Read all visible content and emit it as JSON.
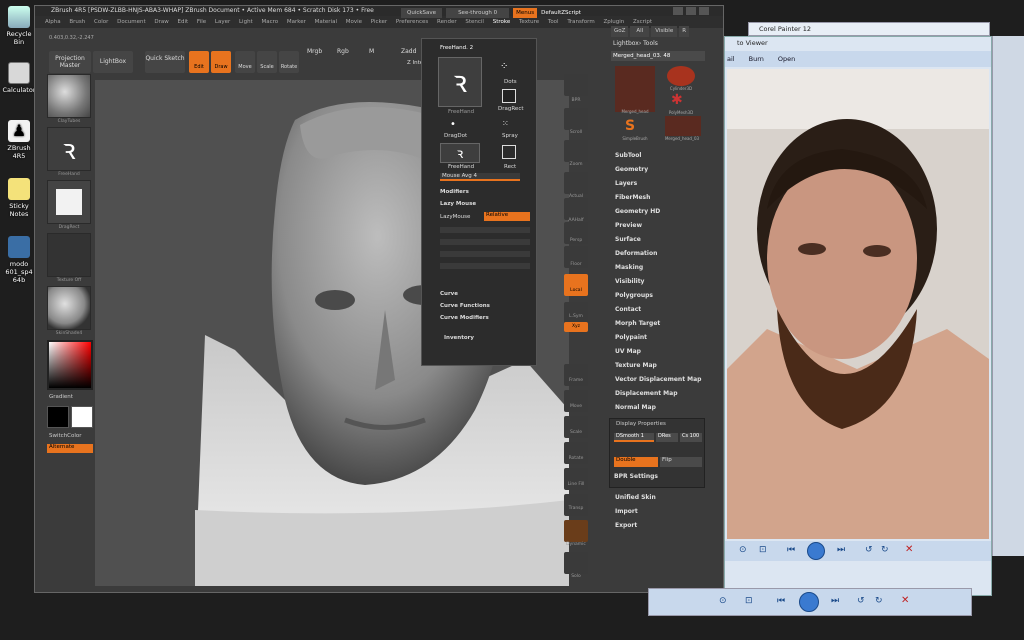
{
  "desktop": {
    "icons": [
      {
        "label": "Recycle Bin"
      },
      {
        "label": "Calculator"
      },
      {
        "label": "ZBrush 4R5"
      },
      {
        "label": "Sticky Notes"
      },
      {
        "label": "modo 601_sp4 64b"
      }
    ]
  },
  "zbrush": {
    "title": "ZBrush 4R5   [PSDW-ZLBB-HNJS-ABA3-WHAP]   ZBrush Document   • Active Mem 684 • Scratch Disk 173 • Free",
    "top": {
      "quicksave": "QuickSave",
      "seethrough": "See-through 0",
      "menus": "Menus",
      "script": "DefaultZScript"
    },
    "menus": [
      "Alpha",
      "Brush",
      "Color",
      "Document",
      "Draw",
      "Edit",
      "File",
      "Layer",
      "Light",
      "Macro",
      "Marker",
      "Material",
      "Movie",
      "Picker",
      "Preferences",
      "Render",
      "Stencil",
      "Stroke",
      "Texture",
      "Tool",
      "Transform",
      "Zplugin",
      "Zscript"
    ],
    "coords": "0.403,0.32,-2.247",
    "toolbar": {
      "projection_master": "Projection Master",
      "lightbox": "LightBox",
      "quick_sketch": "Quick Sketch",
      "edit": "Edit",
      "draw": "Draw",
      "move": "Move",
      "scale": "Scale",
      "rotate": "Rotate",
      "mrgb": "Mrgb",
      "rgb": "Rgb",
      "m": "M",
      "zadd": "Zadd",
      "zint": "Z Intensi"
    },
    "shelf": {
      "material_label": "ClayTubes",
      "brush_label": "FreeHand",
      "alpha_label": "DragRect",
      "texture_label": "Texture Off",
      "matcap_label": "SkinShade4",
      "gradient": "Gradient",
      "switch_color": "SwitchColor",
      "alternate": "Alternate"
    },
    "stroke_palette": {
      "header": "FreeHand. 2",
      "items": [
        {
          "label": "FreeHand"
        },
        {
          "label": "Dots"
        },
        {
          "label": "DragRect"
        },
        {
          "label": "DragDot"
        },
        {
          "label": "Spray"
        },
        {
          "label": "FreeHand"
        },
        {
          "label": "Rect"
        }
      ],
      "mouse_avg": "Mouse Avg 4",
      "modifiers": "Modifiers",
      "lazy_mouse": "Lazy Mouse",
      "lazymouse_label": "LazyMouse",
      "relative": "Relative",
      "curve": "Curve",
      "curve_functions": "Curve Functions",
      "curve_modifiers": "Curve Modifiers",
      "inventory": "Inventory"
    },
    "right_tools": [
      "BPR",
      "Scroll",
      "Zoom",
      "Actual",
      "AAHalf",
      "Persp",
      "Floor",
      "Local",
      "L.Sym",
      "Xyz",
      "Frame",
      "Move",
      "Scale",
      "Rotate",
      "Line Fill",
      "Transp",
      "Dynamic",
      "Solo"
    ],
    "tool_palette": {
      "goz": "GoZ",
      "all": "All",
      "visible": "Visible",
      "r": "R",
      "lightbox_tools": "Lightbox› Tools",
      "current": "Merged_head_03. 48",
      "thumbs": [
        {
          "label": "Merged_head"
        },
        {
          "label": "Cylinder3D"
        },
        {
          "label": "PolyMesh3D"
        },
        {
          "label": "SimpleBrush"
        },
        {
          "label": "Merged_head_03"
        }
      ],
      "items": [
        "SubTool",
        "Geometry",
        "Layers",
        "FiberMesh",
        "Geometry HD",
        "Preview",
        "Surface",
        "Deformation",
        "Masking",
        "Visibility",
        "Polygroups",
        "Contact",
        "Morph Target",
        "Polypaint",
        "UV Map",
        "Texture Map",
        "Vector Displacement Map",
        "Displacement Map",
        "Normal Map"
      ],
      "display_properties": "Display Properties",
      "dsmooth": "DSmooth 1",
      "dres": "DRes",
      "csize": "Cs 100",
      "double": "Double",
      "flip": "Flip",
      "bpr_settings": "BPR Settings",
      "bottom": [
        "Unified Skin",
        "Import",
        "Export"
      ]
    }
  },
  "photo_viewer": {
    "title": "Corel Painter 12",
    "title2": "to Viewer",
    "menu": [
      "ail",
      "Burn",
      "Open"
    ]
  },
  "colors": {
    "accent": "#e8731e",
    "panel": "#2c2c2c",
    "bg": "#3b3b3b"
  }
}
